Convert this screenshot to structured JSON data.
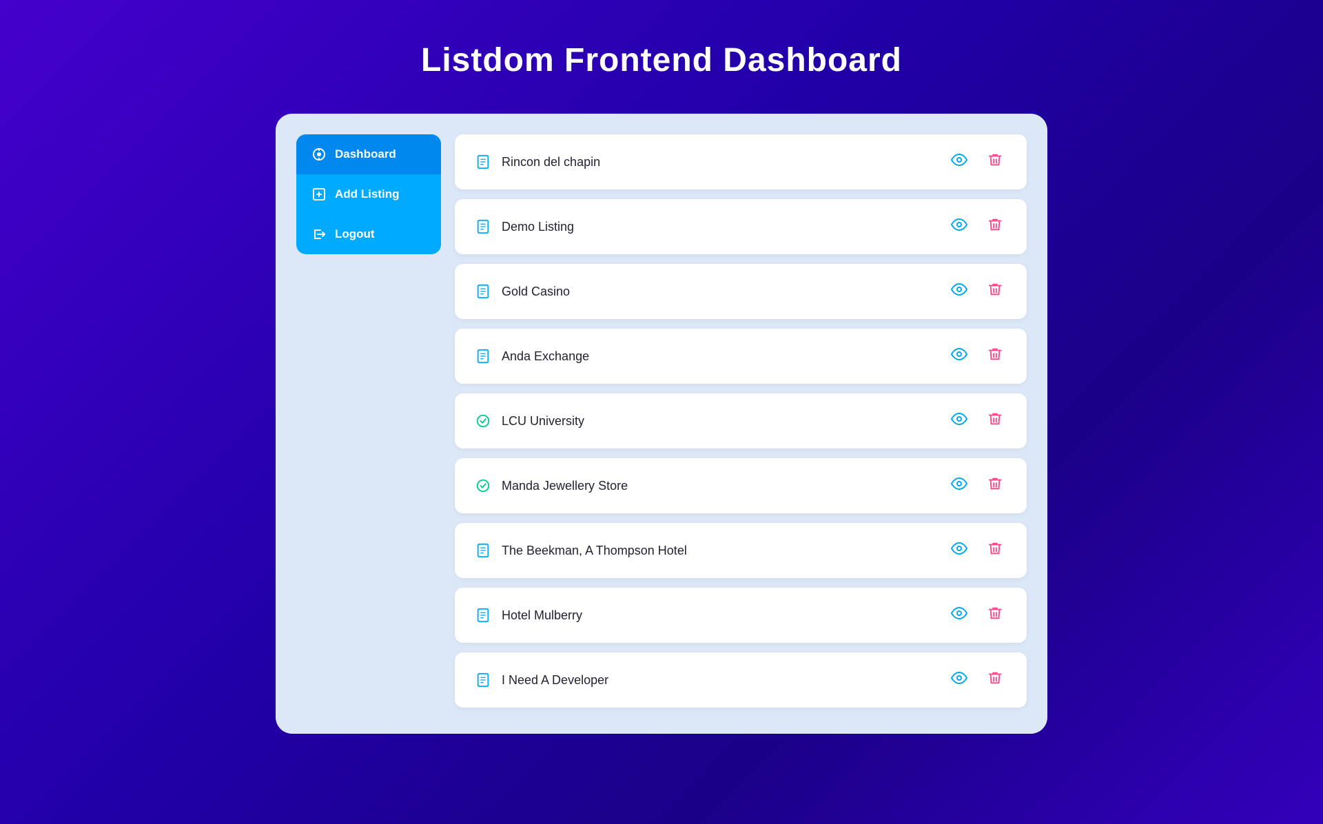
{
  "header": {
    "title": "Listdom Frontend Dashboard"
  },
  "sidebar": {
    "items": [
      {
        "id": "dashboard",
        "label": "Dashboard",
        "icon": "dashboard-icon",
        "active": true
      },
      {
        "id": "add-listing",
        "label": "Add Listing",
        "icon": "add-listing-icon",
        "active": false
      },
      {
        "id": "logout",
        "label": "Logout",
        "icon": "logout-icon",
        "active": false
      }
    ]
  },
  "listings": [
    {
      "id": 1,
      "name": "Rincon del chapin",
      "icon_type": "document",
      "approved": false
    },
    {
      "id": 2,
      "name": "Demo Listing",
      "icon_type": "document",
      "approved": false
    },
    {
      "id": 3,
      "name": "Gold Casino",
      "icon_type": "document",
      "approved": false
    },
    {
      "id": 4,
      "name": "Anda Exchange",
      "icon_type": "document",
      "approved": false
    },
    {
      "id": 5,
      "name": "LCU University",
      "icon_type": "check",
      "approved": true
    },
    {
      "id": 6,
      "name": "Manda Jewellery Store",
      "icon_type": "check",
      "approved": true
    },
    {
      "id": 7,
      "name": "The Beekman, A Thompson Hotel",
      "icon_type": "document",
      "approved": false
    },
    {
      "id": 8,
      "name": "Hotel Mulberry",
      "icon_type": "document",
      "approved": false
    },
    {
      "id": 9,
      "name": "I Need A Developer",
      "icon_type": "document",
      "approved": false
    }
  ],
  "actions": {
    "view_label": "View",
    "delete_label": "Delete"
  }
}
